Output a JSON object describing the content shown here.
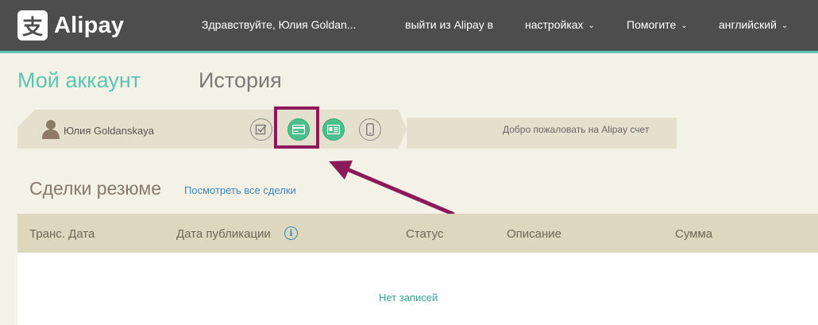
{
  "header": {
    "logo_glyph": "支",
    "logo_text": "Alipay",
    "greeting": "Здравствуйте, Юлия Goldan...",
    "logout": "выйти из Alipay в",
    "settings": "настройках",
    "help": "Помогите",
    "language": "английский"
  },
  "tabs": {
    "account": "Мой аккаунт",
    "history": "История"
  },
  "account_strip": {
    "user_name": "Юлия Goldanskaya",
    "welcome": "Добро пожаловать на Alipay счет",
    "icons": [
      "checkbox-icon",
      "bank-card-icon",
      "id-card-icon",
      "mobile-phone-icon"
    ]
  },
  "transactions": {
    "title": "Сделки резюме",
    "view_all": "Посмотреть все сделки",
    "columns": [
      "Транс. Дата",
      "Дата публикации",
      "Статус",
      "Описание",
      "Сумма"
    ],
    "info_glyph": "i",
    "empty": "Нет записей"
  },
  "colors": {
    "accent": "#5cc6b4",
    "highlight": "#8c1a5a",
    "link": "#3e87b8",
    "header_bg": "#4d4d4d"
  }
}
